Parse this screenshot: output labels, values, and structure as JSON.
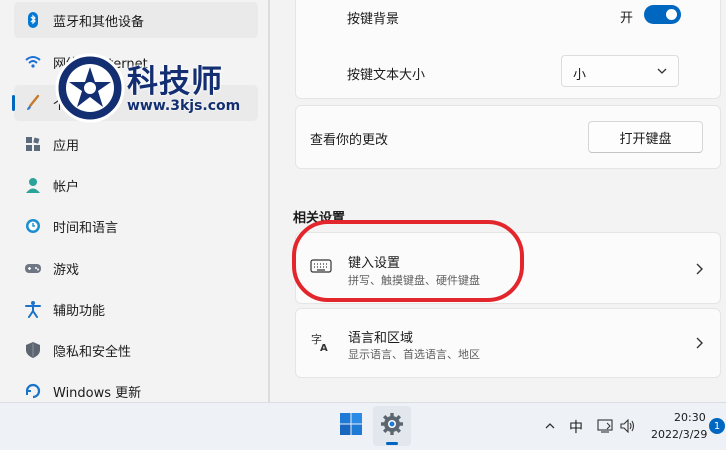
{
  "sidebar": {
    "items": [
      {
        "label": "蓝牙和其他设备",
        "icon": "bluetooth-icon"
      },
      {
        "label": "网络和 Internet",
        "icon": "wifi-icon"
      },
      {
        "label": "个性化",
        "icon": "brush-icon"
      },
      {
        "label": "应用",
        "icon": "apps-icon"
      },
      {
        "label": "帐户",
        "icon": "account-icon"
      },
      {
        "label": "时间和语言",
        "icon": "time-language-icon"
      },
      {
        "label": "游戏",
        "icon": "gamepad-icon"
      },
      {
        "label": "辅助功能",
        "icon": "accessibility-icon"
      },
      {
        "label": "隐私和安全性",
        "icon": "shield-icon"
      },
      {
        "label": "Windows 更新",
        "icon": "windows-update-icon"
      }
    ]
  },
  "watermark": {
    "title": "科技师",
    "url": "www.3kjs.com"
  },
  "keyboard_settings": {
    "key_background_label": "按键背景",
    "key_background_state": "开",
    "key_text_size_label": "按键文本大小",
    "key_text_size_value": "小",
    "view_changes_label": "查看你的更改",
    "open_keyboard_button": "打开键盘"
  },
  "related": {
    "title": "相关设置",
    "items": [
      {
        "title": "键入设置",
        "subtitle": "拼写、触摸键盘、硬件键盘",
        "icon": "keyboard-icon"
      },
      {
        "title": "语言和区域",
        "subtitle": "显示语言、首选语言、地区",
        "icon": "language-icon"
      }
    ]
  },
  "taskbar": {
    "input_method": "中",
    "time": "20:30",
    "date": "2022/3/29",
    "notification_count": "1"
  },
  "colors": {
    "accent": "#0067c0",
    "highlight": "#e3262b"
  }
}
